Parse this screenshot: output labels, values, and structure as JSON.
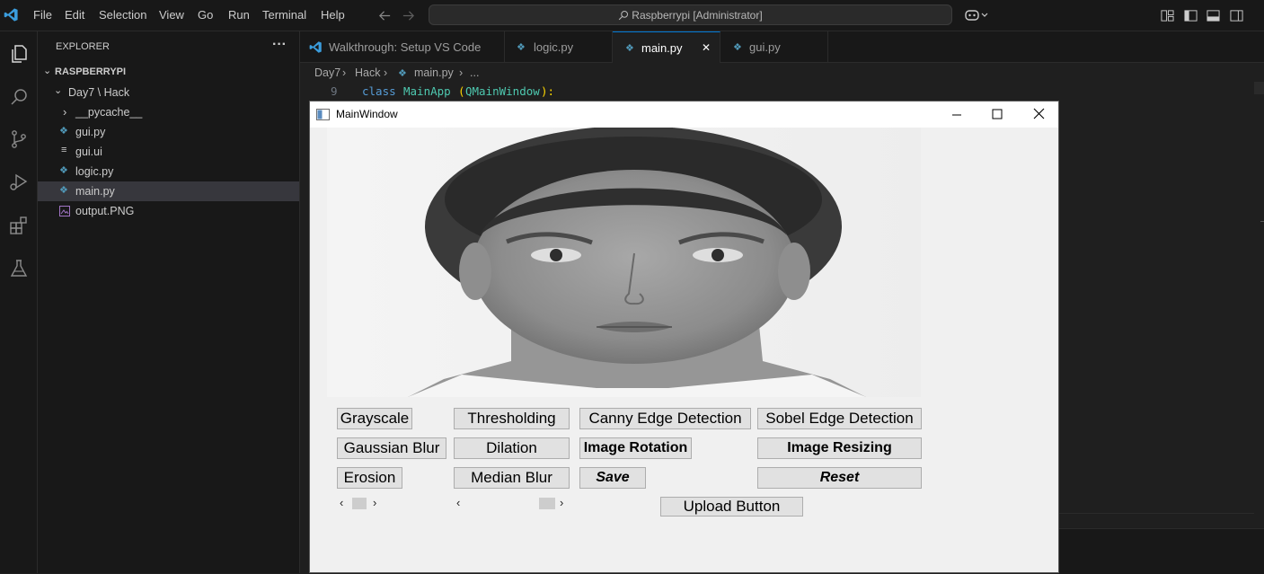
{
  "titlebar": {
    "menu": [
      "File",
      "Edit",
      "Selection",
      "View",
      "Go",
      "Run",
      "Terminal",
      "Help"
    ],
    "command_center": "Raspberrypi [Administrator]"
  },
  "sidebar": {
    "title": "EXPLORER",
    "more": "···",
    "root": "RASPBERRYPI",
    "folder": "Day7 \\ Hack",
    "items": [
      "__pycache__",
      "gui.py",
      "gui.ui",
      "logic.py",
      "main.py",
      "output.PNG"
    ]
  },
  "tabs": [
    {
      "label": "Walkthrough: Setup VS Code"
    },
    {
      "label": "logic.py"
    },
    {
      "label": "main.py",
      "close": "✕"
    },
    {
      "label": "gui.py"
    }
  ],
  "breadcrumb": {
    "parts": [
      "Day7",
      "Hack",
      "main.py",
      "..."
    ]
  },
  "code": {
    "line_number": "9",
    "keyword": "class",
    "class_name": "MainApp",
    "base": "QMainWindow",
    "suffix": "):",
    "open_paren": "("
  },
  "qt_window": {
    "title": "MainWindow",
    "buttons": {
      "grayscale": "Grayscale",
      "thresholding": "Thresholding",
      "canny": "Canny Edge Detection",
      "sobel": "Sobel Edge Detection",
      "gaussian": "Gaussian Blur",
      "dilation": "Dilation",
      "rotation": "Image Rotation",
      "resizing": "Image Resizing",
      "erosion": "Erosion",
      "median": "Median Blur",
      "save": "Save",
      "reset": "Reset",
      "upload": "Upload Button"
    },
    "slider_left_value": 0.3,
    "slider_right_value": 0.85
  },
  "colors": {
    "accent": "#0078d4",
    "python_icon": "#519aba",
    "png_icon": "#a074c4",
    "keyword": "#569cd6",
    "class": "#4ec9b0"
  }
}
